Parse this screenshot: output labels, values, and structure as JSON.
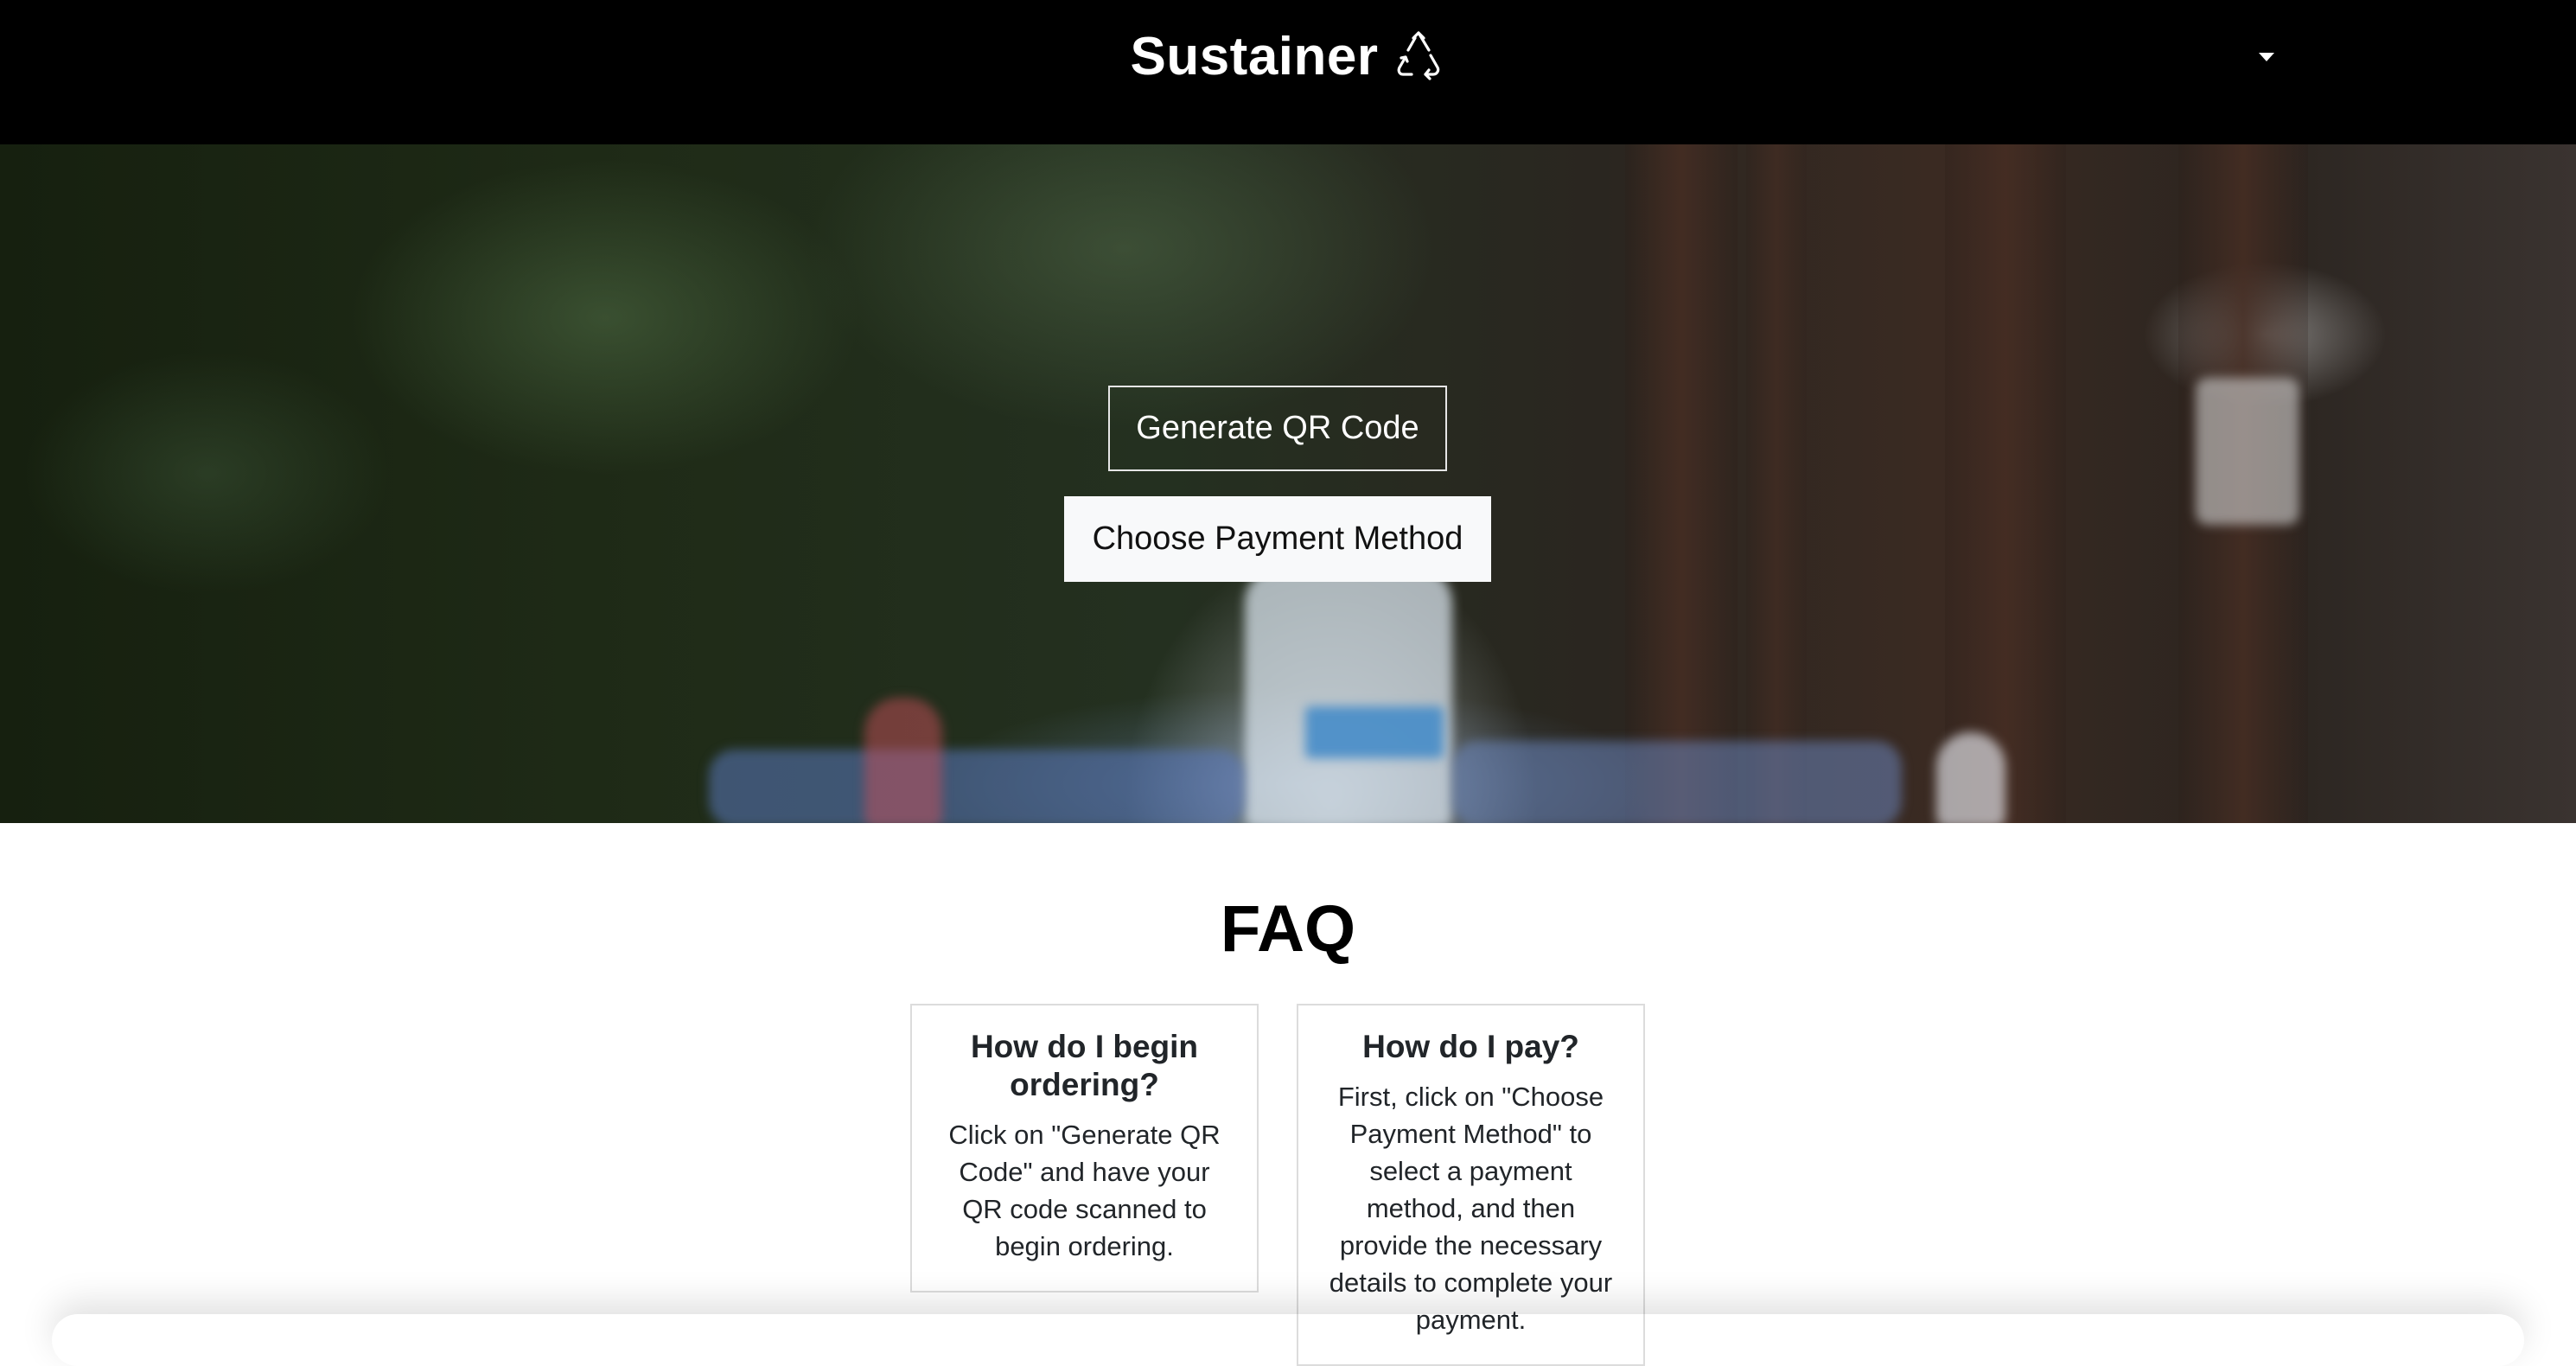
{
  "nav": {
    "brand": "Sustainer",
    "brand_icon": "recycle-icon",
    "dropdown_icon": "caret-down-icon"
  },
  "hero": {
    "generate_qr_label": "Generate QR Code",
    "choose_payment_label": "Choose Payment Method"
  },
  "faq": {
    "title": "FAQ",
    "items": [
      {
        "question": "How do I begin ordering?",
        "answer": "Click on \"Generate QR Code\" and have your QR code scanned to begin ordering."
      },
      {
        "question": "How do I pay?",
        "answer": "First, click on \"Choose Payment Method\" to select a payment method, and then provide the necessary details to complete your payment."
      }
    ]
  }
}
